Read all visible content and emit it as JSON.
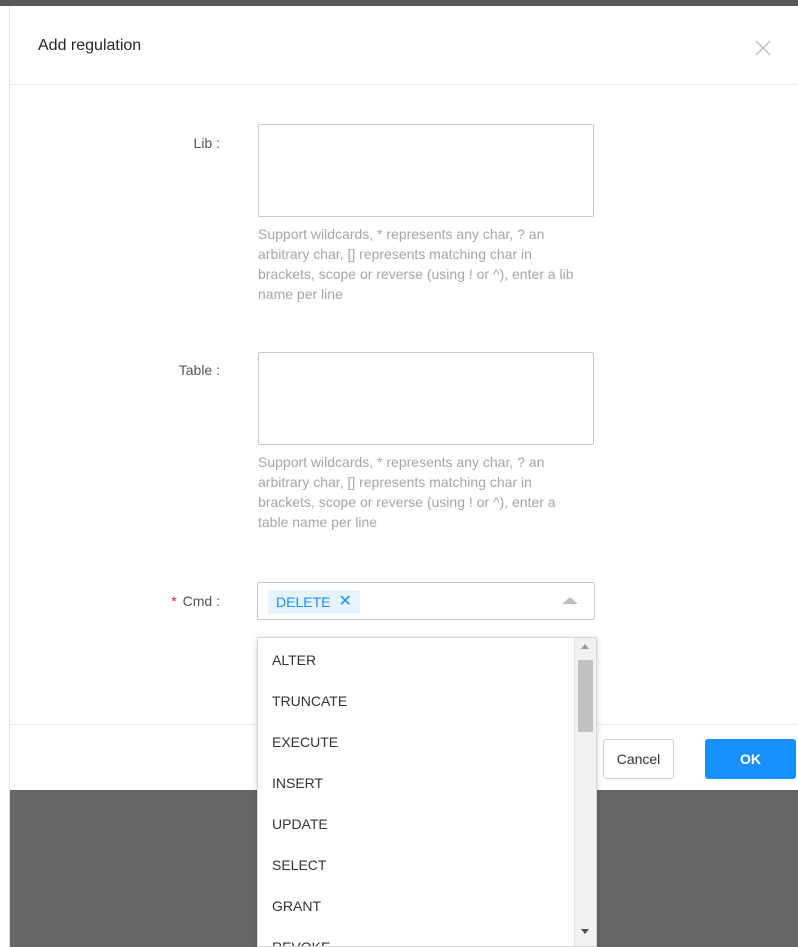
{
  "dialog": {
    "title": "Add regulation",
    "close_icon": "close-icon"
  },
  "form": {
    "lib": {
      "label": "Lib :",
      "value": "",
      "hint": "Support wildcards, * represents any char, ? an arbitrary char, [] represents matching char in brackets, scope or reverse (using ! or ^), enter a lib name per line"
    },
    "table": {
      "label": "Table :",
      "value": "",
      "hint": "Support wildcards, * represents any char, ? an arbitrary char, [] represents matching char in brackets, scope or reverse (using ! or ^), enter a table name per line"
    },
    "cmd": {
      "required_mark": "*",
      "label": "Cmd :",
      "selected_tags": [
        "DELETE"
      ],
      "tag_remove_glyph": "✕",
      "options": [
        "ALTER",
        "TRUNCATE",
        "EXECUTE",
        "INSERT",
        "UPDATE",
        "SELECT",
        "GRANT",
        "REVOKE"
      ]
    }
  },
  "footer": {
    "cancel_label": "Cancel",
    "ok_label": "OK"
  },
  "colors": {
    "primary": "#1890ff",
    "required": "#f5222d",
    "tag_bg": "#e6f4ff",
    "hint_text": "#a6a6a6",
    "backdrop": "#666666"
  }
}
